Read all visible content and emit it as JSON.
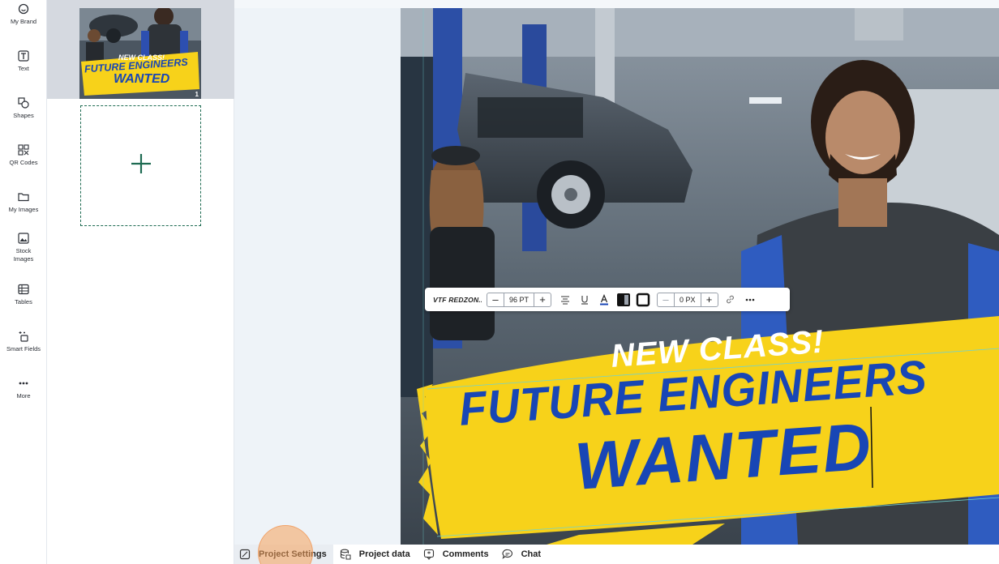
{
  "sidebar": {
    "tools": [
      {
        "label": "My Brand",
        "icon": "brand-icon"
      },
      {
        "label": "Text",
        "icon": "text-icon"
      },
      {
        "label": "Shapes",
        "icon": "shapes-icon"
      },
      {
        "label": "QR Codes",
        "icon": "qr-code-icon"
      },
      {
        "label": "My Images",
        "icon": "folder-icon"
      },
      {
        "label": "Stock\nImages",
        "icon": "image-icon"
      },
      {
        "label": "Tables",
        "icon": "table-icon"
      },
      {
        "label": "Smart Fields",
        "icon": "smart-fields-icon"
      },
      {
        "label": "More",
        "icon": "more-dots-icon"
      }
    ]
  },
  "pages": {
    "thumbnail": {
      "number": "1",
      "line1": "NEW CLASS!",
      "line2": "FUTURE ENGINEERS",
      "line3": "WANTED"
    },
    "add_icon": "plus-icon"
  },
  "design": {
    "headline_small": "NEW CLASS!",
    "headline_main": "FUTURE ENGINEERS",
    "headline_big": "WANTED",
    "accent_yellow": "#f7d21a",
    "text_blue": "#1846b5"
  },
  "text_toolbar": {
    "font_name": "VTF REDZON...",
    "font_size": "96 PT",
    "letter_spacing": "0 PX"
  },
  "bottom_bar": {
    "project_settings": "Project Settings",
    "project_data": "Project data",
    "comments": "Comments",
    "chat": "Chat"
  }
}
